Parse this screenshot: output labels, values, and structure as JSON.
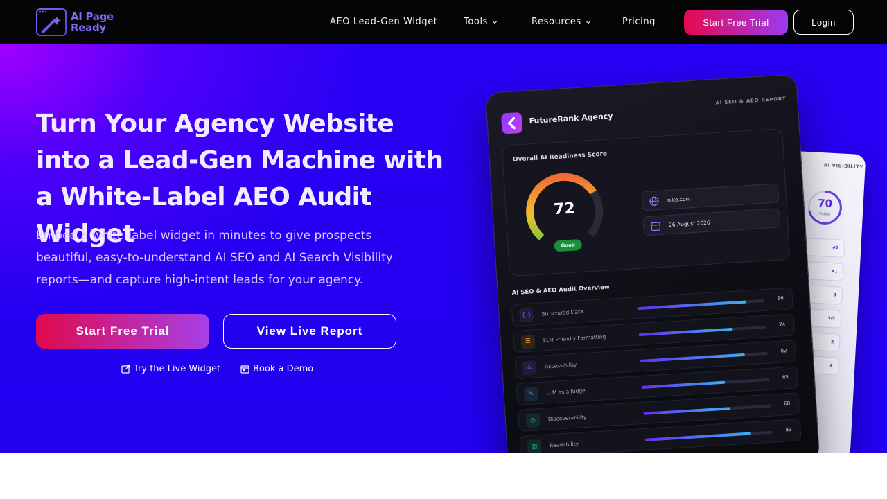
{
  "nav": {
    "logo_line1": "AI Page",
    "logo_line2": "Ready",
    "links": [
      "AEO Lead-Gen Widget",
      "Tools",
      "Resources",
      "Pricing"
    ],
    "trial_label": "Start Free Trial",
    "login_label": "Login"
  },
  "hero": {
    "title": "Turn Your Agency Website into a Lead-Gen Machine with a White-Label AEO Audit Widget",
    "subtitle": "Embed a white-label widget in minutes to give prospects beautiful, easy-to-understand AI SEO and AI Search Visibility reports—and capture high-intent leads for your agency.",
    "cta_primary": "Start Free Trial",
    "cta_secondary": "View Live Report",
    "link_widget": "Try the Live Widget",
    "link_demo": "Book a Demo"
  },
  "report": {
    "agency_name": "FutureRank Agency",
    "report_label": "AI SEO & AEO REPORT",
    "score_title": "Overall AI Readiness Score",
    "score": 72,
    "score_text": "72",
    "score_badge": "Good",
    "domain": "nike.com",
    "date": "26 August 2026",
    "overview_title": "AI SEO & AEO Audit Overview",
    "rows": [
      {
        "label": "Structured Data",
        "value": 86,
        "value_text": "86",
        "icon": "code-braces-icon",
        "color": "#7b5cff"
      },
      {
        "label": "LLM-Friendly Formatting",
        "value": 74,
        "value_text": "74",
        "icon": "list-icon",
        "color": "#f0a020"
      },
      {
        "label": "Accessibility",
        "value": 82,
        "value_text": "82",
        "icon": "accessibility-icon",
        "color": "#7b5cff"
      },
      {
        "label": "LLM as a Judge",
        "value": 65,
        "value_text": "65",
        "icon": "chat-bubble-icon",
        "color": "#3ab0f4"
      },
      {
        "label": "Discoverability",
        "value": 68,
        "value_text": "68",
        "icon": "radar-icon",
        "color": "#20c08a"
      },
      {
        "label": "Readability",
        "value": 83,
        "value_text": "83",
        "icon": "book-icon",
        "color": "#20c08a"
      }
    ]
  },
  "back_report": {
    "title": "AI VISIBILITY",
    "score": 70,
    "score_text": "70",
    "score_label": "Visible",
    "rows": [
      "#2",
      "#1",
      "3",
      "3/5",
      "2",
      "4"
    ]
  },
  "colors": {
    "nav_bg": "#050505",
    "hero_bg": "#2200f0",
    "accent_pink": "#e5094f",
    "accent_purple": "#9b3bf0",
    "good_green": "#1c8d3a"
  }
}
